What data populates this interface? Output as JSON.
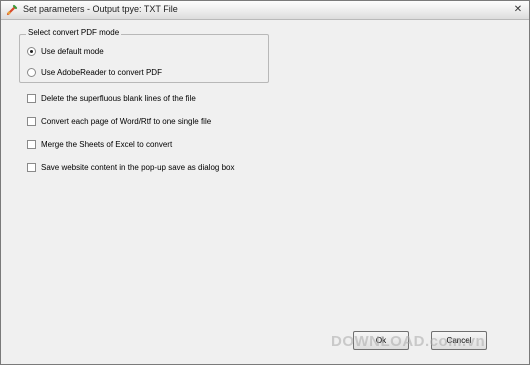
{
  "window": {
    "title": "Set parameters - Output tpye: TXT File",
    "close_glyph": "✕"
  },
  "mode_group": {
    "legend": "Select convert PDF mode",
    "options": [
      {
        "label": "Use default mode",
        "selected": true
      },
      {
        "label": "Use AdobeReader to convert PDF",
        "selected": false
      }
    ]
  },
  "checkboxes": [
    {
      "label": "Delete the superfluous blank lines of the file",
      "checked": false
    },
    {
      "label": "Convert each page of Word/Rtf to one single file",
      "checked": false
    },
    {
      "label": "Merge the Sheets of Excel to convert",
      "checked": false
    },
    {
      "label": "Save website content in the pop-up save as dialog box",
      "checked": false
    }
  ],
  "buttons": {
    "ok_label": "Ok",
    "cancel_label": "Cancel"
  },
  "watermark": "DOWNLOAD.com.vn"
}
